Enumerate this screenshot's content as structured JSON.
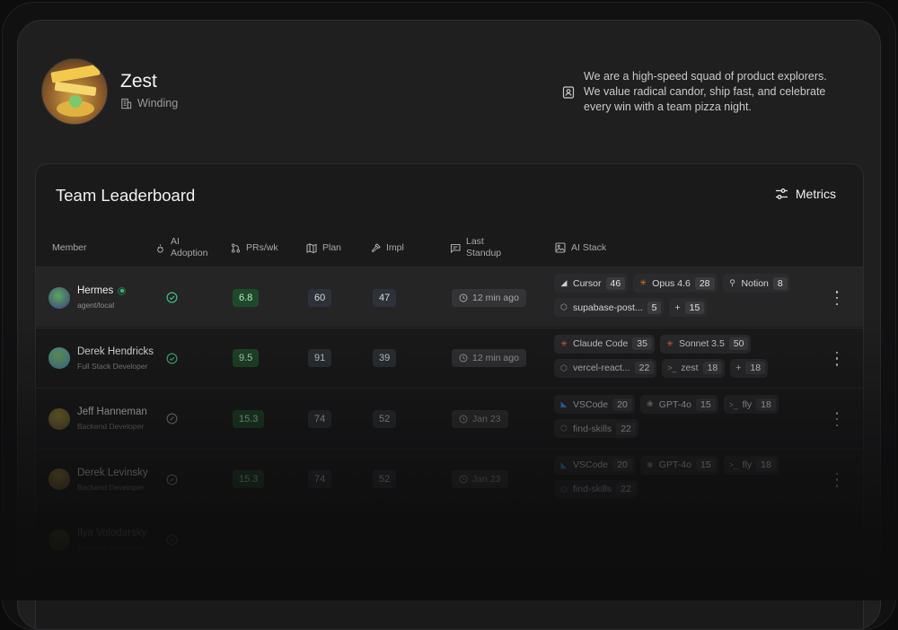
{
  "team": {
    "name": "Zest",
    "type": "Winding",
    "description": "We are a high-speed squad of product explorers. We value radical candor, ship fast, and celebrate every win with a team pizza night."
  },
  "leaderboard": {
    "title": "Team Leaderboard",
    "metrics_label": "Metrics",
    "columns": {
      "member": "Member",
      "ai_adoption_1": "AI",
      "ai_adoption_2": "Adoption",
      "prs": "PRs/wk",
      "plan": "Plan",
      "impl": "Impl",
      "standup_1": "Last",
      "standup_2": "Standup",
      "ai_stack": "AI Stack"
    },
    "rows": [
      {
        "name": "Hermes",
        "role": "agent/local",
        "online": true,
        "adoption": "check",
        "prs": "6.8",
        "plan": "60",
        "impl": "47",
        "standup": "12 min ago",
        "stack": [
          {
            "icon": "cursor-icon",
            "label": "Cursor",
            "count": "46"
          },
          {
            "icon": "anthropic-icon",
            "label": "Opus 4.6",
            "count": "28"
          },
          {
            "icon": "plug-icon",
            "label": "Notion",
            "count": "8"
          },
          {
            "icon": "package-icon",
            "label": "supabase-post...",
            "count": "5"
          },
          {
            "icon": "plus-icon",
            "label": "+",
            "count": "15"
          }
        ]
      },
      {
        "name": "Derek Hendricks",
        "role": "Full Stack Developer",
        "online": false,
        "adoption": "check",
        "prs": "9.5",
        "plan": "91",
        "impl": "39",
        "standup": "12 min ago",
        "stack": [
          {
            "icon": "anthropic-icon",
            "label": "Claude Code",
            "count": "35"
          },
          {
            "icon": "anthropic-icon",
            "label": "Sonnet 3.5",
            "count": "50"
          },
          {
            "icon": "package-icon",
            "label": "vercel-react...",
            "count": "22"
          },
          {
            "icon": "terminal-icon",
            "label": "zest",
            "count": "18"
          },
          {
            "icon": "plus-icon",
            "label": "+",
            "count": "18"
          }
        ]
      },
      {
        "name": "Jeff Hanneman",
        "role": "Backend Developer",
        "online": false,
        "adoption": "pending",
        "prs": "15.3",
        "plan": "74",
        "impl": "52",
        "standup": "Jan 23",
        "stack": [
          {
            "icon": "vscode-icon",
            "label": "VSCode",
            "count": "20"
          },
          {
            "icon": "openai-icon",
            "label": "GPT-4o",
            "count": "15"
          },
          {
            "icon": "terminal-icon",
            "label": "fly",
            "count": "18"
          },
          {
            "icon": "package-icon",
            "label": "find-skills",
            "count": "22"
          }
        ]
      },
      {
        "name": "Derek Levinsky",
        "role": "Backend Developer",
        "online": false,
        "adoption": "pending",
        "prs": "15.3",
        "plan": "74",
        "impl": "52",
        "standup": "Jan 23",
        "stack": [
          {
            "icon": "vscode-icon",
            "label": "VSCode",
            "count": "20"
          },
          {
            "icon": "openai-icon",
            "label": "GPT-4o",
            "count": "15"
          },
          {
            "icon": "terminal-icon",
            "label": "fly",
            "count": "18"
          },
          {
            "icon": "package-icon",
            "label": "find-skills",
            "count": "22"
          }
        ]
      },
      {
        "name": "Ilya Volodarsky",
        "role": "Backend Developer",
        "online": false,
        "adoption": "pending",
        "prs": "",
        "plan": "",
        "impl": "",
        "standup": "",
        "stack": []
      }
    ]
  },
  "colors": {
    "accent_green": "#1f4a2a",
    "check_green": "#3fbf7f",
    "vscode_blue": "#3a8ee6",
    "anthropic_orange": "#e8743b"
  }
}
